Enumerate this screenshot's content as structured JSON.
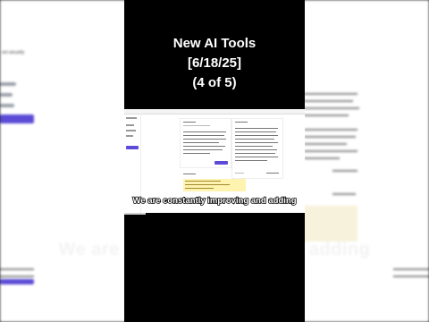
{
  "video": {
    "title_lines": [
      "New AI Tools",
      "[6/18/25]",
      "(4 of 5)"
    ],
    "caption": "We are constantly improving and adding",
    "background_caption": "We are co... and adding",
    "background_caption_left": "We are co",
    "background_caption_right": "nd adding"
  },
  "progress": {
    "fraction": 0.12
  },
  "colors": {
    "accent": "#5b4bd6",
    "highlight": "#fff3b0",
    "background": "#000000"
  }
}
